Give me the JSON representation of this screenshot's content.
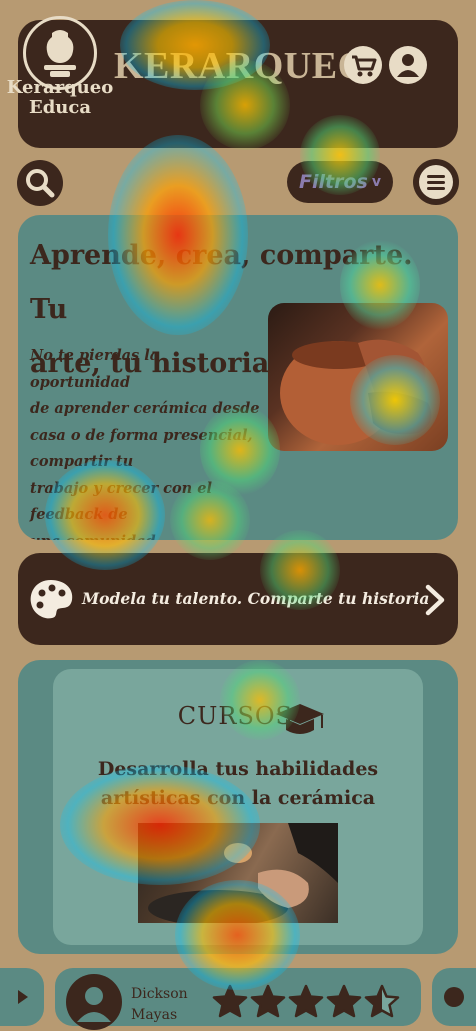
{
  "header": {
    "logo_text_line1": "Kerarqueo",
    "logo_text_line2": "Educa",
    "brand": "KERARQUEO",
    "icons": [
      "cart-icon",
      "user-icon"
    ]
  },
  "toolbar": {
    "search_icon": "search-icon",
    "filter_label": "Filtros",
    "filter_chevron": "v",
    "menu_icon": "menu-icon"
  },
  "hero": {
    "title_line1": "Aprende, crea, comparte. Tu",
    "title_line2": "arte, tu historia.",
    "text_lines": [
      "No te pierdas la oportunidad",
      "de aprender cerámica desde",
      "casa o de forma presencial,",
      "compartir tu",
      "trabajo y crecer con el",
      "feedback de",
      "una comunidad."
    ]
  },
  "banner": {
    "icon": "palette-icon",
    "text": "Modela tu talento. Comparte tu historia",
    "arrow": "chevron-right-icon"
  },
  "courses": {
    "title": "CURSOS",
    "icon": "graduation-cap-icon",
    "subtitle_line1": "Desarrolla tus habilidades",
    "subtitle_line2": "artísticas con la cerámica"
  },
  "testimonial": {
    "name_line1": "Dickson",
    "name_line2": "Mayas",
    "rating": 4.5,
    "max_rating": 5
  },
  "colors": {
    "background": "#b79a72",
    "dark_brown": "#3c271d",
    "teal": "#5b8a83",
    "light_teal": "#79a69c",
    "cream": "#e8dcc6"
  }
}
